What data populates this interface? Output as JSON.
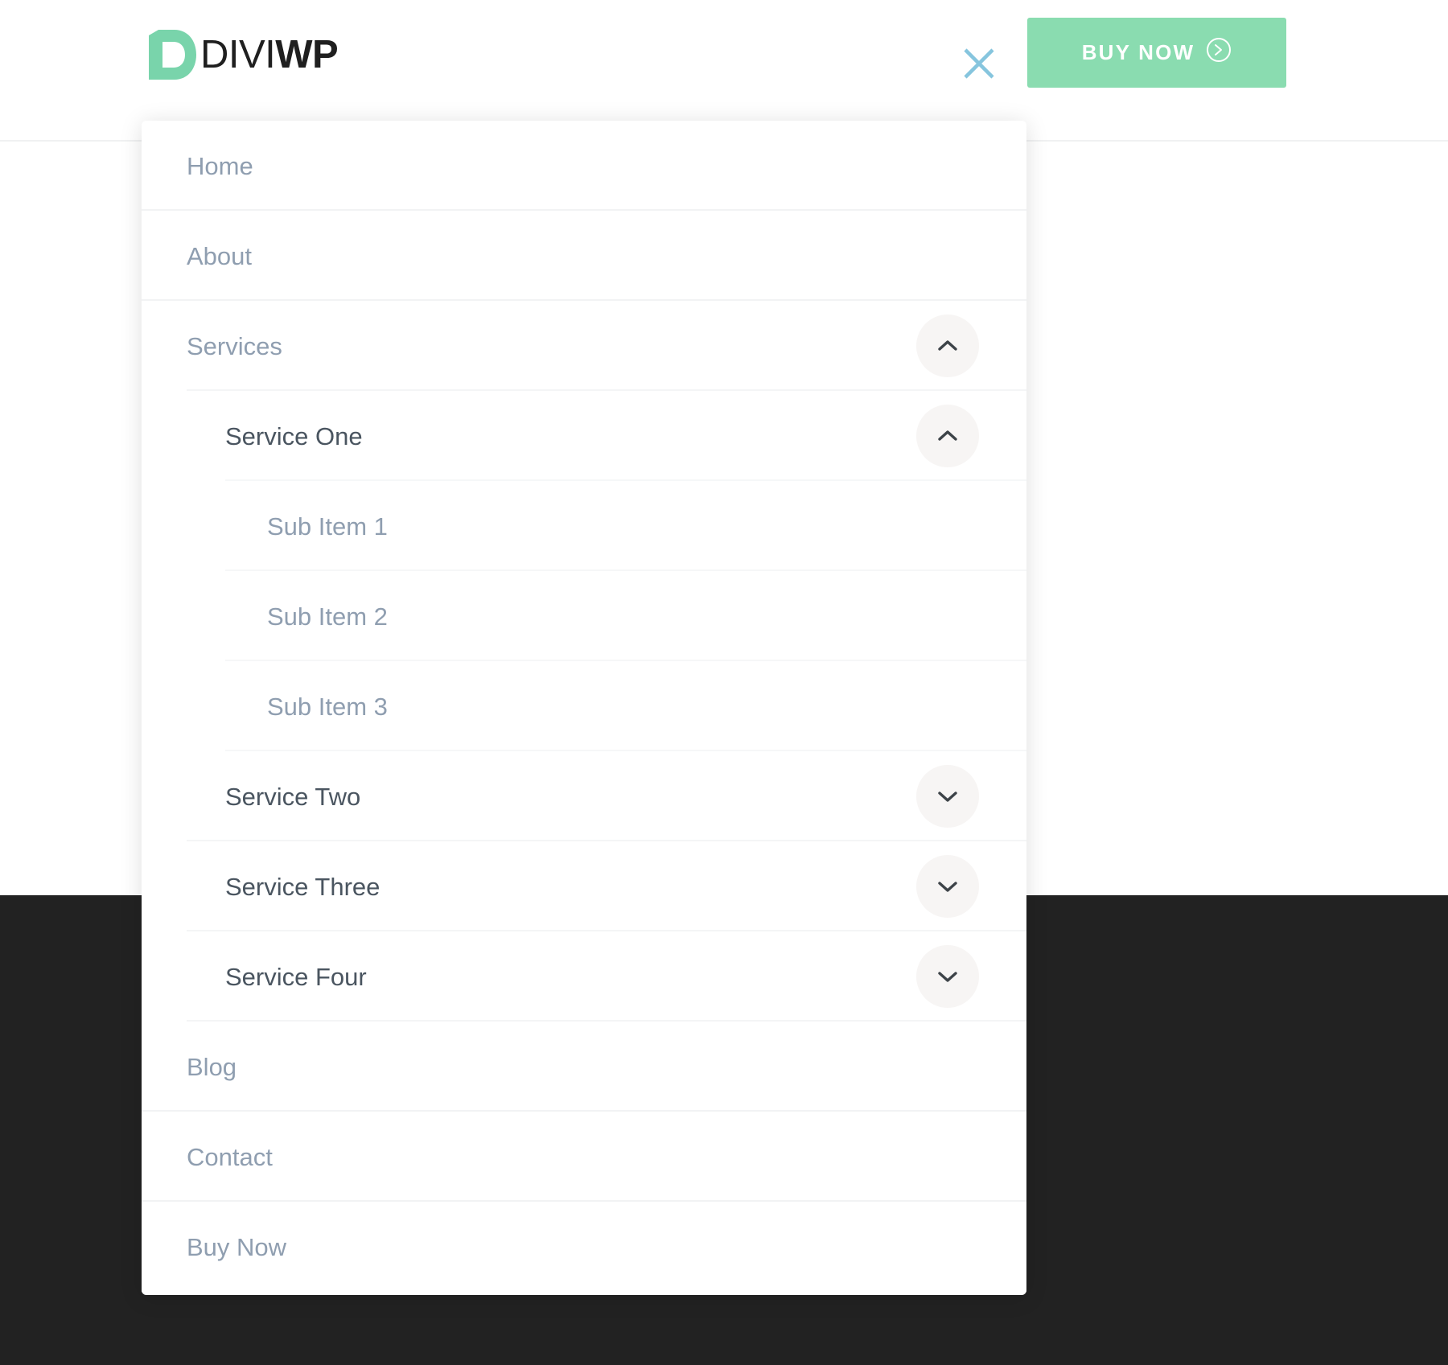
{
  "brand": {
    "logo_mark": "diviwp-d-mark",
    "name_light": "DIVI",
    "name_bold": "WP",
    "accent_color": "#8adcb0",
    "close_icon_color": "#86c5de"
  },
  "header": {
    "close_label": "Close menu",
    "close_icon": "close-x-icon",
    "buy_button": {
      "label": "BUY NOW",
      "icon": "arrow-right-circle-icon"
    }
  },
  "menu": {
    "items": [
      {
        "label": "Home",
        "level": 1,
        "toggle": null
      },
      {
        "label": "About",
        "level": 1,
        "toggle": null
      },
      {
        "label": "Services",
        "level": 1,
        "toggle": "chevron-up-icon"
      },
      {
        "label": "Service One",
        "level": 2,
        "toggle": "chevron-up-icon"
      },
      {
        "label": "Sub Item 1",
        "level": 3,
        "toggle": null
      },
      {
        "label": "Sub Item 2",
        "level": 3,
        "toggle": null
      },
      {
        "label": "Sub Item 3",
        "level": 3,
        "toggle": null
      },
      {
        "label": "Service Two",
        "level": 2,
        "toggle": "chevron-down-icon"
      },
      {
        "label": "Service Three",
        "level": 2,
        "toggle": "chevron-down-icon"
      },
      {
        "label": "Service Four",
        "level": 2,
        "toggle": "chevron-down-icon"
      },
      {
        "label": "Blog",
        "level": 1,
        "toggle": null
      },
      {
        "label": "Contact",
        "level": 1,
        "toggle": null
      },
      {
        "label": "Buy Now",
        "level": 1,
        "toggle": null
      }
    ]
  },
  "background": {
    "light_color": "#ffffff",
    "dark_color": "#222222"
  }
}
